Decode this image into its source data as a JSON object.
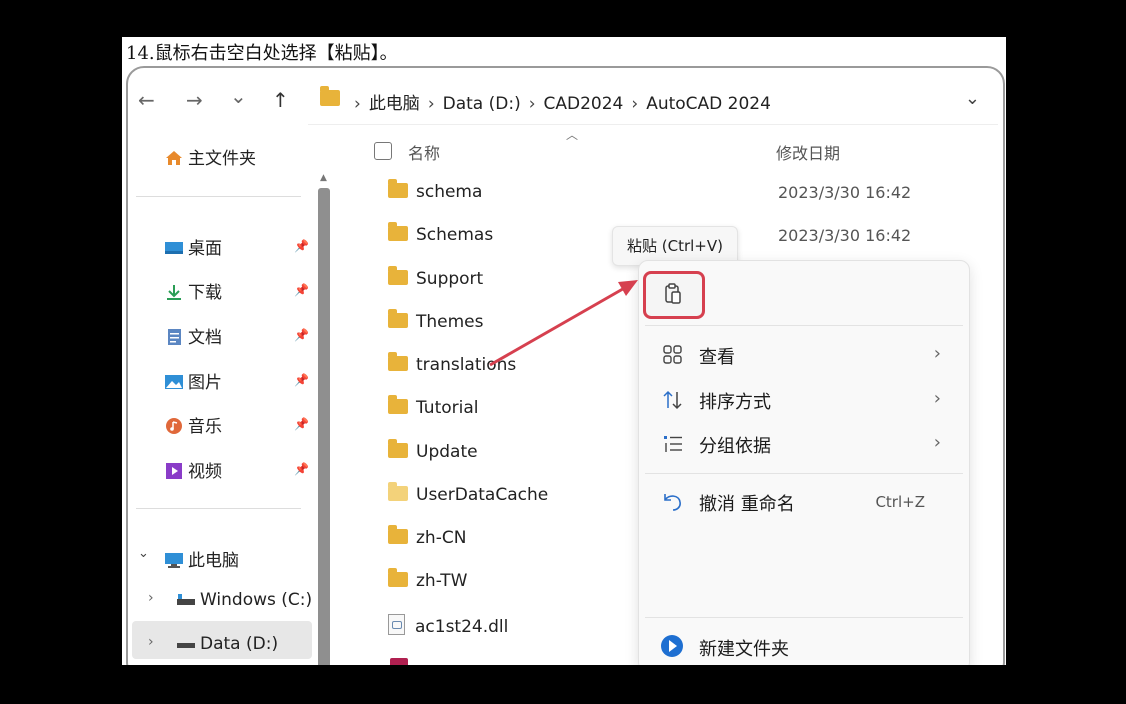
{
  "instruction": "14.鼠标右击空白处选择【粘贴】。",
  "nav": {
    "back": "←",
    "forward": "→",
    "recent": "⌄",
    "up": "↑"
  },
  "breadcrumb": [
    "此电脑",
    "Data (D:)",
    "CAD2024",
    "AutoCAD 2024"
  ],
  "breadcrumb_sep": "›",
  "sidebar": {
    "home": "主文件夹",
    "quick": [
      {
        "label": "桌面",
        "icon": "desktop-icon"
      },
      {
        "label": "下载",
        "icon": "download-icon"
      },
      {
        "label": "文档",
        "icon": "documents-icon"
      },
      {
        "label": "图片",
        "icon": "pictures-icon"
      },
      {
        "label": "音乐",
        "icon": "music-icon"
      },
      {
        "label": "视频",
        "icon": "video-icon"
      }
    ],
    "this_pc": "此电脑",
    "drives": [
      "Windows (C:)",
      "Data (D:)"
    ]
  },
  "columns": {
    "name": "名称",
    "modified": "修改日期"
  },
  "files": [
    {
      "name": "schema",
      "date": "2023/3/30 16:42"
    },
    {
      "name": "Schemas",
      "date": "2023/3/30 16:42"
    },
    {
      "name": "Support",
      "date": ""
    },
    {
      "name": "Themes",
      "date": ""
    },
    {
      "name": "translations",
      "date": ""
    },
    {
      "name": "Tutorial",
      "date": ""
    },
    {
      "name": "Update",
      "date": ""
    },
    {
      "name": "UserDataCache",
      "date": ""
    },
    {
      "name": "zh-CN",
      "date": ""
    },
    {
      "name": "zh-TW",
      "date": ""
    },
    {
      "name": "ac1st24.dll",
      "date": ""
    }
  ],
  "tooltip": "粘贴 (Ctrl+V)",
  "context_menu": {
    "view": "查看",
    "sort": "排序方式",
    "group": "分组依据",
    "undo": "撤消 重命名",
    "undo_shortcut": "Ctrl+Z",
    "new_folder": "新建文件夹",
    "submenu_arrow": "›"
  },
  "colors": {
    "highlight": "#d6404f",
    "folder": "#e8b33a",
    "accent": "#1e6fd1"
  }
}
